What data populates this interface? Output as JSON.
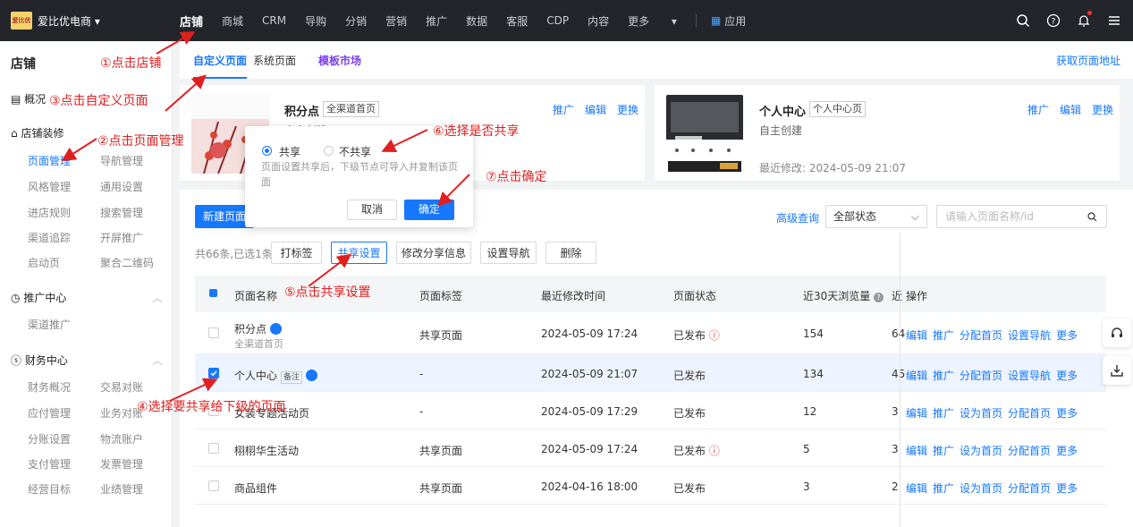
{
  "topbar": {
    "logo_text": "爱比优",
    "shop_name": "爱比优电商",
    "nav": [
      "店铺",
      "商城",
      "CRM",
      "导购",
      "分销",
      "营销",
      "推广",
      "数据",
      "客服",
      "CDP",
      "内容",
      "更多"
    ],
    "apps_label": "应用"
  },
  "sidebar": {
    "title": "店铺",
    "overview": "概况",
    "decoration": "店铺装修",
    "decoration_items": [
      "页面管理",
      "导航管理",
      "风格管理",
      "通用设置",
      "进店规则",
      "搜索管理",
      "渠道追踪",
      "开屏推广",
      "启动页",
      "聚合二维码"
    ],
    "promo_center": "推广中心",
    "promo_items": [
      "渠道推广"
    ],
    "finance_center": "财务中心",
    "finance_items": [
      "财务概况",
      "交易对账",
      "应付管理",
      "业务对账",
      "分账设置",
      "物流账户",
      "支付管理",
      "发票管理",
      "经营目标",
      "业绩管理"
    ]
  },
  "tabs": {
    "custom": "自定义页面",
    "system": "系统页面",
    "market": "模板市场",
    "get_address": "获取页面地址"
  },
  "cards": [
    {
      "title": "积分点",
      "tag": "全渠道首页",
      "sub": "自主创建",
      "actions": [
        "推广",
        "编辑",
        "更换"
      ]
    },
    {
      "title": "个人中心",
      "tag": "个人中心页",
      "sub": "自主创建",
      "modified": "最近修改: 2024-05-09 21:07",
      "actions": [
        "推广",
        "编辑",
        "更换"
      ]
    }
  ],
  "popover": {
    "opt_share": "共享",
    "opt_noshare": "不共享",
    "hint": "页面设置共享后，下级节点可导入并复制该页面",
    "cancel": "取消",
    "confirm": "确定"
  },
  "toolbar": {
    "new_page": "新建页面",
    "advanced_query": "高级查询",
    "status_select": "全部状态",
    "search_placeholder": "请输入页面名称/id",
    "count_text": "共66条,已选1条",
    "buttons": [
      "打标签",
      "共享设置",
      "修改分享信息",
      "设置导航",
      "删除"
    ]
  },
  "table": {
    "headers": [
      "页面名称",
      "页面标签",
      "最近修改时间",
      "页面状态",
      "近30天浏览量",
      "近",
      "操作"
    ],
    "rows": [
      {
        "name": "积分点",
        "sub": "全渠道首页",
        "label": "共享页面",
        "time": "2024-05-09 17:24",
        "status": "已发布",
        "views": "154",
        "extra": "64",
        "ops": [
          "编辑",
          "推广",
          "分配首页",
          "设置导航",
          "更多"
        ]
      },
      {
        "name": "个人中心",
        "badge": "备注",
        "label": "-",
        "time": "2024-05-09 21:07",
        "status": "已发布",
        "views": "134",
        "extra": "45",
        "ops": [
          "编辑",
          "推广",
          "分配首页",
          "设置导航",
          "更多"
        ]
      },
      {
        "name": "女装专题活动页",
        "label": "-",
        "time": "2024-05-09 17:29",
        "status": "已发布",
        "views": "12",
        "extra": "3",
        "ops": [
          "编辑",
          "推广",
          "设为首页",
          "分配首页",
          "更多"
        ]
      },
      {
        "name": "栩栩华生活动",
        "label": "共享页面",
        "time": "2024-05-09 17:24",
        "status": "已发布",
        "views": "5",
        "extra": "3",
        "ops": [
          "编辑",
          "推广",
          "设为首页",
          "分配首页",
          "更多"
        ]
      },
      {
        "name": "商品组件",
        "label": "共享页面",
        "time": "2024-04-16 18:00",
        "status": "已发布",
        "views": "3",
        "extra": "2",
        "ops": [
          "编辑",
          "推广",
          "设为首页",
          "分配首页",
          "更多"
        ]
      }
    ]
  },
  "annotations": {
    "a1": "①点击店铺",
    "a2": "②点击页面管理",
    "a3": "③点击自定义页面",
    "a4": "④选择要共享给下级的页面",
    "a5": "⑤点击共享设置",
    "a6": "⑥选择是否共享",
    "a7": "⑦点击确定"
  },
  "colors": {
    "accent": "#1677ff",
    "annotation": "#e02020",
    "topbar": "#23252b",
    "market": "#7a3ef0"
  }
}
